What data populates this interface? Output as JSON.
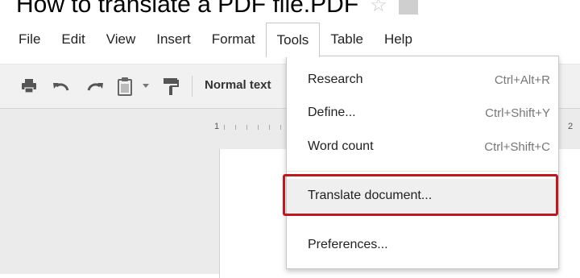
{
  "document": {
    "title": "How to translate a PDF file.PDF"
  },
  "icons": {
    "star": "star-icon",
    "folder": "folder-icon",
    "print": "print-icon",
    "undo": "undo-icon",
    "redo": "redo-icon",
    "paste": "paste-icon",
    "dropdown": "caret-down-icon",
    "paint_format": "paint-format-icon"
  },
  "menubar": {
    "items": [
      "File",
      "Edit",
      "View",
      "Insert",
      "Format",
      "Tools",
      "Table",
      "Help"
    ],
    "active": "Tools"
  },
  "toolbar": {
    "style_select": "Normal text"
  },
  "ruler": {
    "marks": [
      "1",
      "2"
    ]
  },
  "tools_menu": {
    "items": [
      {
        "label": "Research",
        "shortcut": "Ctrl+Alt+R"
      },
      {
        "label": "Define...",
        "shortcut": "Ctrl+Shift+Y"
      },
      {
        "label": "Word count",
        "shortcut": "Ctrl+Shift+C"
      },
      {
        "label": "Translate document...",
        "shortcut": ""
      },
      {
        "label": "Preferences...",
        "shortcut": ""
      }
    ],
    "highlighted_item": "Translate document..."
  },
  "colors": {
    "highlight_border": "#c0181d",
    "toolbar_bg": "#f1f1f1",
    "canvas_bg": "#ebebeb"
  }
}
